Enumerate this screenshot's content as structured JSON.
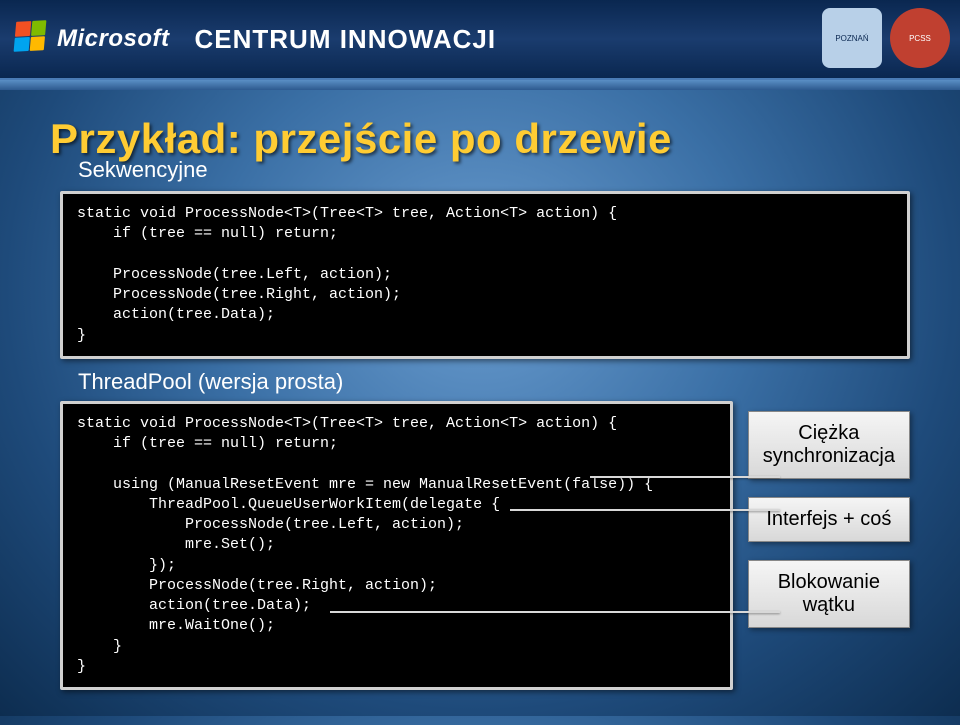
{
  "header": {
    "logo_text": "Microsoft",
    "center_title": "CENTRUM INNOWACJI",
    "badge1": "POZNAŃ",
    "badge2": "PCSS"
  },
  "slide": {
    "title": "Przykład: przejście po drzewie",
    "subtitle1": "Sekwencyjne",
    "subtitle2": "ThreadPool (wersja prosta)"
  },
  "code1": "static void ProcessNode<T>(Tree<T> tree, Action<T> action) {\n    if (tree == null) return;\n\n    ProcessNode(tree.Left, action);\n    ProcessNode(tree.Right, action);\n    action(tree.Data);\n}",
  "code2": "static void ProcessNode<T>(Tree<T> tree, Action<T> action) {\n    if (tree == null) return;\n\n    using (ManualResetEvent mre = new ManualResetEvent(false)) {\n        ThreadPool.QueueUserWorkItem(delegate {\n            ProcessNode(tree.Left, action);\n            mre.Set();\n        });\n        ProcessNode(tree.Right, action);\n        action(tree.Data);\n        mre.WaitOne();\n    }\n}",
  "callouts": {
    "c1_line1": "Ciężka",
    "c1_line2": "synchronizacja",
    "c2": "Interfejs + coś",
    "c3_line1": "Blokowanie",
    "c3_line2": "wątku"
  }
}
